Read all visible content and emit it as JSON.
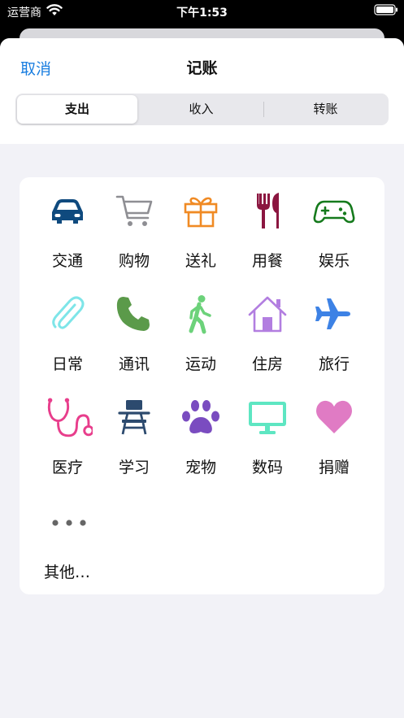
{
  "status_bar": {
    "carrier": "运营商",
    "time": "下午1:53"
  },
  "header": {
    "cancel_label": "取消",
    "title": "记账",
    "segments": [
      "支出",
      "收入",
      "转账"
    ],
    "selected_segment": "支出"
  },
  "categories": [
    {
      "label": "交通",
      "icon": "car-icon",
      "color": "#0f4a7e"
    },
    {
      "label": "购物",
      "icon": "shopping-cart-icon",
      "color": "#8e8e93"
    },
    {
      "label": "送礼",
      "icon": "gift-icon",
      "color": "#f08a24"
    },
    {
      "label": "用餐",
      "icon": "utensils-icon",
      "color": "#8b1640"
    },
    {
      "label": "娱乐",
      "icon": "gamepad-icon",
      "color": "#157a1c"
    },
    {
      "label": "日常",
      "icon": "paperclip-icon",
      "color": "#7ee5e8"
    },
    {
      "label": "通讯",
      "icon": "phone-icon",
      "color": "#5b9a4a"
    },
    {
      "label": "运动",
      "icon": "walking-icon",
      "color": "#6cd27a"
    },
    {
      "label": "住房",
      "icon": "house-icon",
      "color": "#b27ee0"
    },
    {
      "label": "旅行",
      "icon": "airplane-icon",
      "color": "#3d82e5"
    },
    {
      "label": "医疗",
      "icon": "stethoscope-icon",
      "color": "#e83e8c"
    },
    {
      "label": "学习",
      "icon": "school-desk-icon",
      "color": "#2c4a6e"
    },
    {
      "label": "宠物",
      "icon": "paw-icon",
      "color": "#7a4cc0"
    },
    {
      "label": "数码",
      "icon": "monitor-icon",
      "color": "#5ee6c2"
    },
    {
      "label": "捐赠",
      "icon": "heart-icon",
      "color": "#e07bc4"
    }
  ],
  "other": {
    "label": "其他…",
    "icon": "more-dots-icon",
    "color": "#666666"
  }
}
